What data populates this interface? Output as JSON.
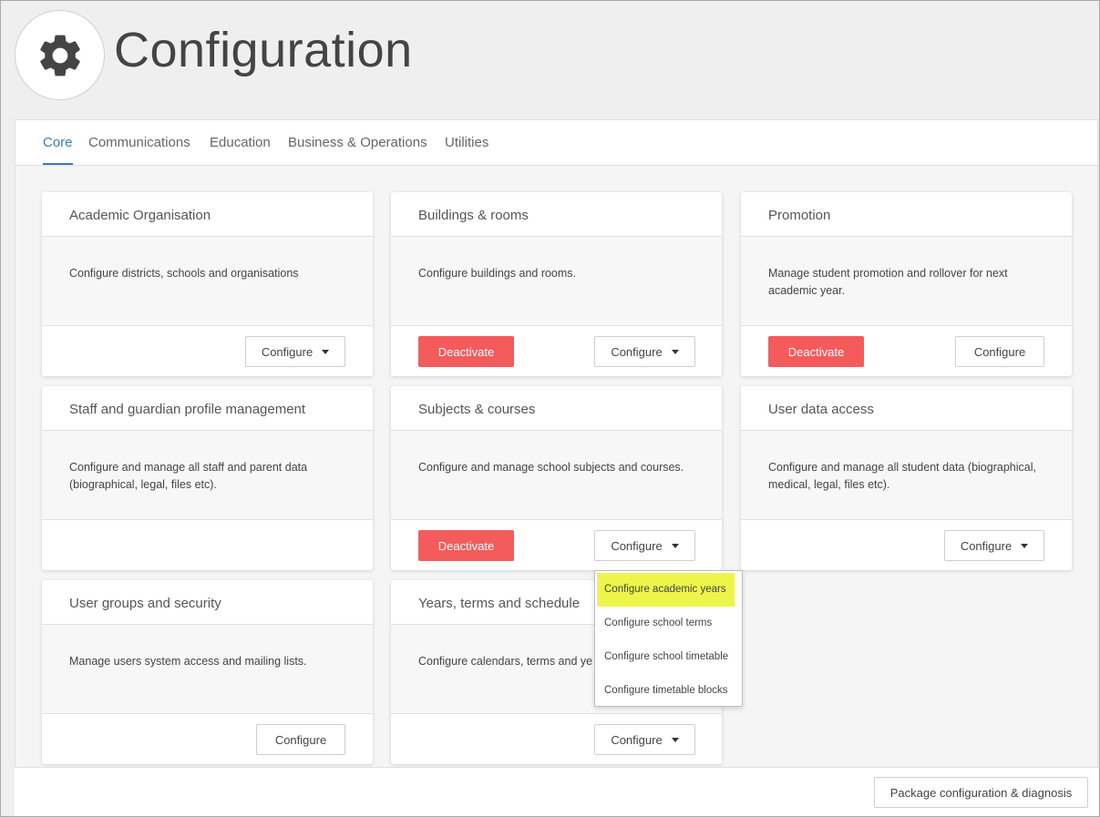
{
  "header": {
    "icon": "gear-icon",
    "title": "Configuration"
  },
  "tabs": [
    {
      "label": "Core",
      "active": true
    },
    {
      "label": "Communications"
    },
    {
      "label": "Education"
    },
    {
      "label": "Business & Operations"
    },
    {
      "label": "Utilities"
    }
  ],
  "buttons": {
    "configure": "Configure",
    "deactivate": "Deactivate"
  },
  "cards": {
    "academic_organisation": {
      "title": "Academic Organisation",
      "description": "Configure districts, schools and organisations"
    },
    "buildings_rooms": {
      "title": "Buildings & rooms",
      "description": "Configure buildings and rooms."
    },
    "promotion": {
      "title": "Promotion",
      "description": "Manage student promotion and rollover for next academic year."
    },
    "staff_guardian": {
      "title": "Staff and guardian profile management",
      "description": "Configure and manage all staff and parent data (biographical, legal, files etc)."
    },
    "subjects_courses": {
      "title": "Subjects & courses",
      "description": "Configure and manage school subjects and courses."
    },
    "user_data_access": {
      "title": "User data access",
      "description": "Configure and manage all student data (biographical, medical, legal, files etc)."
    },
    "user_groups_security": {
      "title": "User groups and security",
      "description": "Manage users system access and mailing lists."
    },
    "years_terms_schedule": {
      "title": "Years, terms and schedule",
      "description": "Configure calendars, terms and ye"
    }
  },
  "dropdown": {
    "items": [
      {
        "label": "Configure academic years",
        "highlighted": true
      },
      {
        "label": "Configure school terms"
      },
      {
        "label": "Configure school timetable"
      },
      {
        "label": "Configure timetable blocks"
      }
    ]
  },
  "footer": {
    "package_button": "Package configuration & diagnosis"
  },
  "colors": {
    "accent": "#3a7bc0",
    "deactivate": "#f45b5b",
    "highlight": "#eef54a"
  }
}
